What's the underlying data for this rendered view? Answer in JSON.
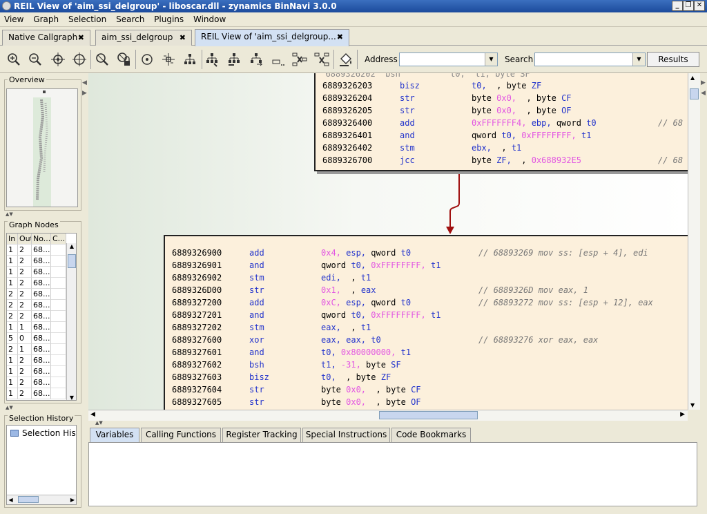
{
  "window": {
    "title": "REIL View of 'aim_ssi_delgroup' - liboscar.dll - zynamics BinNavi 3.0.0"
  },
  "menu": [
    "View",
    "Graph",
    "Selection",
    "Search",
    "Plugins",
    "Window"
  ],
  "tabs": [
    {
      "label": "Native Callgraph"
    },
    {
      "label": "aim_ssi_delgroup"
    },
    {
      "label": "REIL View of 'aim_ssi_delgroup..."
    }
  ],
  "toolbar": {
    "address_label": "Address",
    "address_value": "",
    "search_label": "Search",
    "search_value": "",
    "results_label": "Results",
    "icons": [
      "zoom-in-icon",
      "zoom-out-icon",
      "zoom-selection-icon",
      "fit-graph-icon",
      "clear-selection-icon",
      "lock-icon",
      "circular-layout-icon",
      "orthogonal-layout-icon",
      "hierarchical-layout-icon",
      "select-children-icon",
      "select-parents-icon",
      "select-successors-icon",
      "select-predecessors-icon",
      "delete-nodes-icon",
      "expand-nodes-icon",
      "paint-bucket-icon"
    ]
  },
  "panels": {
    "overview_title": "Overview",
    "graph_nodes_title": "Graph Nodes",
    "graph_nodes_headers": [
      "In",
      "Out",
      "No...",
      "C..."
    ],
    "graph_nodes_rows": [
      [
        "1",
        "2",
        "68...",
        ""
      ],
      [
        "1",
        "2",
        "68...",
        ""
      ],
      [
        "1",
        "2",
        "68...",
        ""
      ],
      [
        "1",
        "2",
        "68...",
        ""
      ],
      [
        "2",
        "2",
        "68...",
        ""
      ],
      [
        "2",
        "2",
        "68...",
        ""
      ],
      [
        "2",
        "2",
        "68...",
        ""
      ],
      [
        "1",
        "1",
        "68...",
        ""
      ],
      [
        "5",
        "0",
        "68...",
        ""
      ],
      [
        "2",
        "1",
        "68...",
        ""
      ],
      [
        "1",
        "2",
        "68...",
        ""
      ],
      [
        "1",
        "2",
        "68...",
        ""
      ],
      [
        "1",
        "2",
        "68...",
        ""
      ],
      [
        "1",
        "2",
        "68...",
        ""
      ]
    ],
    "history_title": "Selection History",
    "history_item": "Selection Histo"
  },
  "graph": {
    "block1": [
      {
        "addr": "6889326203",
        "op": "bisz",
        "args": [
          {
            "t": "t0,",
            "c": "reg"
          },
          {
            "t": "  , byte ",
            "c": ""
          },
          {
            "t": "ZF",
            "c": "reg"
          }
        ],
        "comment": ""
      },
      {
        "addr": "6889326204",
        "op": "str",
        "args": [
          {
            "t": "byte ",
            "c": ""
          },
          {
            "t": "0x0,",
            "c": "num"
          },
          {
            "t": "  , byte ",
            "c": ""
          },
          {
            "t": "CF",
            "c": "reg"
          }
        ],
        "comment": ""
      },
      {
        "addr": "6889326205",
        "op": "str",
        "args": [
          {
            "t": "byte ",
            "c": ""
          },
          {
            "t": "0x0,",
            "c": "num"
          },
          {
            "t": "  , byte ",
            "c": ""
          },
          {
            "t": "OF",
            "c": "reg"
          }
        ],
        "comment": ""
      },
      {
        "addr": "6889326400",
        "op": "add",
        "args": [
          {
            "t": "0xFFFFFFF4,",
            "c": "num"
          },
          {
            "t": " ebp,",
            "c": "reg"
          },
          {
            "t": " qword ",
            "c": ""
          },
          {
            "t": "t0",
            "c": "reg"
          }
        ],
        "comment": "// 68"
      },
      {
        "addr": "6889326401",
        "op": "and",
        "args": [
          {
            "t": "qword ",
            "c": ""
          },
          {
            "t": "t0,",
            "c": "reg"
          },
          {
            "t": " 0xFFFFFFFF,",
            "c": "num"
          },
          {
            "t": " t1",
            "c": "reg"
          }
        ],
        "comment": ""
      },
      {
        "addr": "6889326402",
        "op": "stm",
        "args": [
          {
            "t": "ebx,",
            "c": "reg"
          },
          {
            "t": "  , ",
            "c": ""
          },
          {
            "t": "t1",
            "c": "reg"
          }
        ],
        "comment": ""
      },
      {
        "addr": "6889326700",
        "op": "jcc",
        "args": [
          {
            "t": "byte ",
            "c": ""
          },
          {
            "t": "ZF,",
            "c": "reg"
          },
          {
            "t": "  , ",
            "c": ""
          },
          {
            "t": "0x688932E5",
            "c": "num"
          }
        ],
        "comment": "// 68"
      }
    ],
    "block2": [
      {
        "addr": "6889326900",
        "op": "add",
        "args": [
          {
            "t": "0x4,",
            "c": "num"
          },
          {
            "t": " esp,",
            "c": "reg"
          },
          {
            "t": " qword ",
            "c": ""
          },
          {
            "t": "t0",
            "c": "reg"
          }
        ],
        "comment": "// 68893269 mov ss: [esp + 4], edi"
      },
      {
        "addr": "6889326901",
        "op": "and",
        "args": [
          {
            "t": "qword ",
            "c": ""
          },
          {
            "t": "t0,",
            "c": "reg"
          },
          {
            "t": " 0xFFFFFFFF,",
            "c": "num"
          },
          {
            "t": " t1",
            "c": "reg"
          }
        ],
        "comment": ""
      },
      {
        "addr": "6889326902",
        "op": "stm",
        "args": [
          {
            "t": "edi,",
            "c": "reg"
          },
          {
            "t": "  , ",
            "c": ""
          },
          {
            "t": "t1",
            "c": "reg"
          }
        ],
        "comment": ""
      },
      {
        "addr": "6889326D00",
        "op": "str",
        "args": [
          {
            "t": "0x1,",
            "c": "num"
          },
          {
            "t": "  , ",
            "c": ""
          },
          {
            "t": "eax",
            "c": "reg"
          }
        ],
        "comment": "// 6889326D mov eax, 1"
      },
      {
        "addr": "6889327200",
        "op": "add",
        "args": [
          {
            "t": "0xC,",
            "c": "num"
          },
          {
            "t": " esp,",
            "c": "reg"
          },
          {
            "t": " qword ",
            "c": ""
          },
          {
            "t": "t0",
            "c": "reg"
          }
        ],
        "comment": "// 68893272 mov ss: [esp + 12], eax"
      },
      {
        "addr": "6889327201",
        "op": "and",
        "args": [
          {
            "t": "qword ",
            "c": ""
          },
          {
            "t": "t0,",
            "c": "reg"
          },
          {
            "t": " 0xFFFFFFFF,",
            "c": "num"
          },
          {
            "t": " t1",
            "c": "reg"
          }
        ],
        "comment": ""
      },
      {
        "addr": "6889327202",
        "op": "stm",
        "args": [
          {
            "t": "eax,",
            "c": "reg"
          },
          {
            "t": "  , ",
            "c": ""
          },
          {
            "t": "t1",
            "c": "reg"
          }
        ],
        "comment": ""
      },
      {
        "addr": "6889327600",
        "op": "xor",
        "args": [
          {
            "t": "eax,",
            "c": "reg"
          },
          {
            "t": " eax,",
            "c": "reg"
          },
          {
            "t": " t0",
            "c": "reg"
          }
        ],
        "comment": "// 68893276 xor eax, eax"
      },
      {
        "addr": "6889327601",
        "op": "and",
        "args": [
          {
            "t": "t0,",
            "c": "reg"
          },
          {
            "t": " 0x80000000,",
            "c": "num"
          },
          {
            "t": " t1",
            "c": "reg"
          }
        ],
        "comment": ""
      },
      {
        "addr": "6889327602",
        "op": "bsh",
        "args": [
          {
            "t": "t1,",
            "c": "reg"
          },
          {
            "t": " -31,",
            "c": "num"
          },
          {
            "t": " byte ",
            "c": ""
          },
          {
            "t": "SF",
            "c": "reg"
          }
        ],
        "comment": ""
      },
      {
        "addr": "6889327603",
        "op": "bisz",
        "args": [
          {
            "t": "t0,",
            "c": "reg"
          },
          {
            "t": "  , byte ",
            "c": ""
          },
          {
            "t": "ZF",
            "c": "reg"
          }
        ],
        "comment": ""
      },
      {
        "addr": "6889327604",
        "op": "str",
        "args": [
          {
            "t": "byte ",
            "c": ""
          },
          {
            "t": "0x0,",
            "c": "num"
          },
          {
            "t": "  , byte ",
            "c": ""
          },
          {
            "t": "CF",
            "c": "reg"
          }
        ],
        "comment": ""
      },
      {
        "addr": "6889327605",
        "op": "str",
        "args": [
          {
            "t": "byte ",
            "c": ""
          },
          {
            "t": "0x0,",
            "c": "num"
          },
          {
            "t": "  , byte ",
            "c": ""
          },
          {
            "t": "OF",
            "c": "reg"
          }
        ],
        "comment": ""
      }
    ]
  },
  "bottom_tabs": [
    "Variables",
    "Calling Functions",
    "Register Tracking",
    "Special Instructions",
    "Code Bookmarks"
  ]
}
